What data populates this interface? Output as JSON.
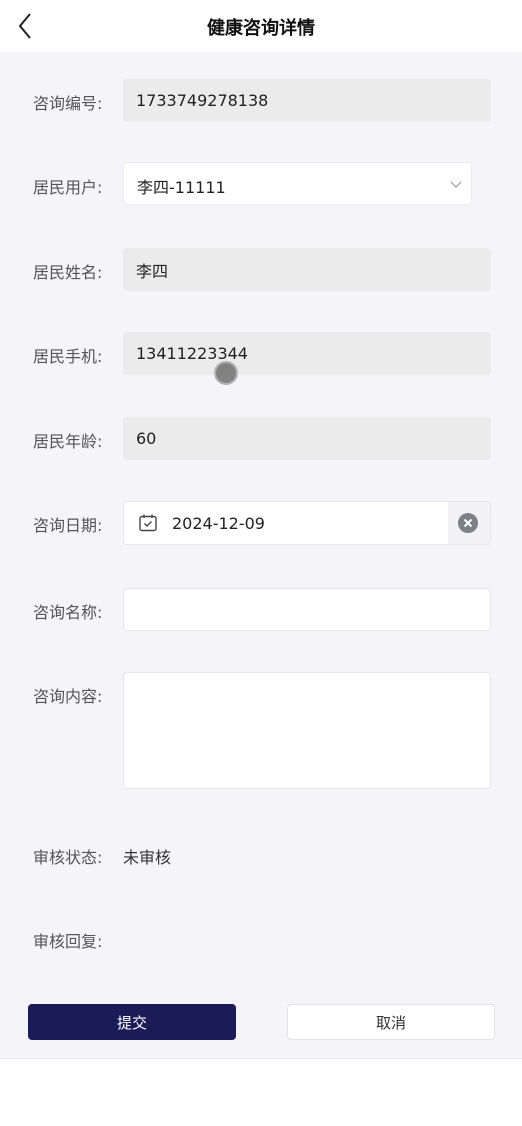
{
  "header": {
    "title": "健康咨询详情"
  },
  "form": {
    "consult_no": {
      "label": "咨询编号:",
      "value": "1733749278138"
    },
    "resident_user": {
      "label": "居民用户:",
      "value": "李四-11111"
    },
    "resident_name": {
      "label": "居民姓名:",
      "value": "李四"
    },
    "resident_phone": {
      "label": "居民手机:",
      "value": "13411223344"
    },
    "resident_age": {
      "label": "居民年龄:",
      "value": "60"
    },
    "consult_date": {
      "label": "咨询日期:",
      "value": "2024-12-09"
    },
    "consult_name": {
      "label": "咨询名称:",
      "value": ""
    },
    "consult_content": {
      "label": "咨询内容:",
      "value": ""
    },
    "review_status": {
      "label": "审核状态:",
      "value": "未审核"
    },
    "review_reply": {
      "label": "审核回复:",
      "value": ""
    }
  },
  "actions": {
    "submit": "提交",
    "cancel": "取消"
  },
  "icons": {
    "back": "chevron-left-icon",
    "dropdown": "chevron-down-icon",
    "calendar": "calendar-icon",
    "clear": "clear-circle-icon"
  },
  "colors": {
    "primary": "#1b1c57",
    "background": "#f5f4f9",
    "readonly_field": "#ebebeb"
  }
}
